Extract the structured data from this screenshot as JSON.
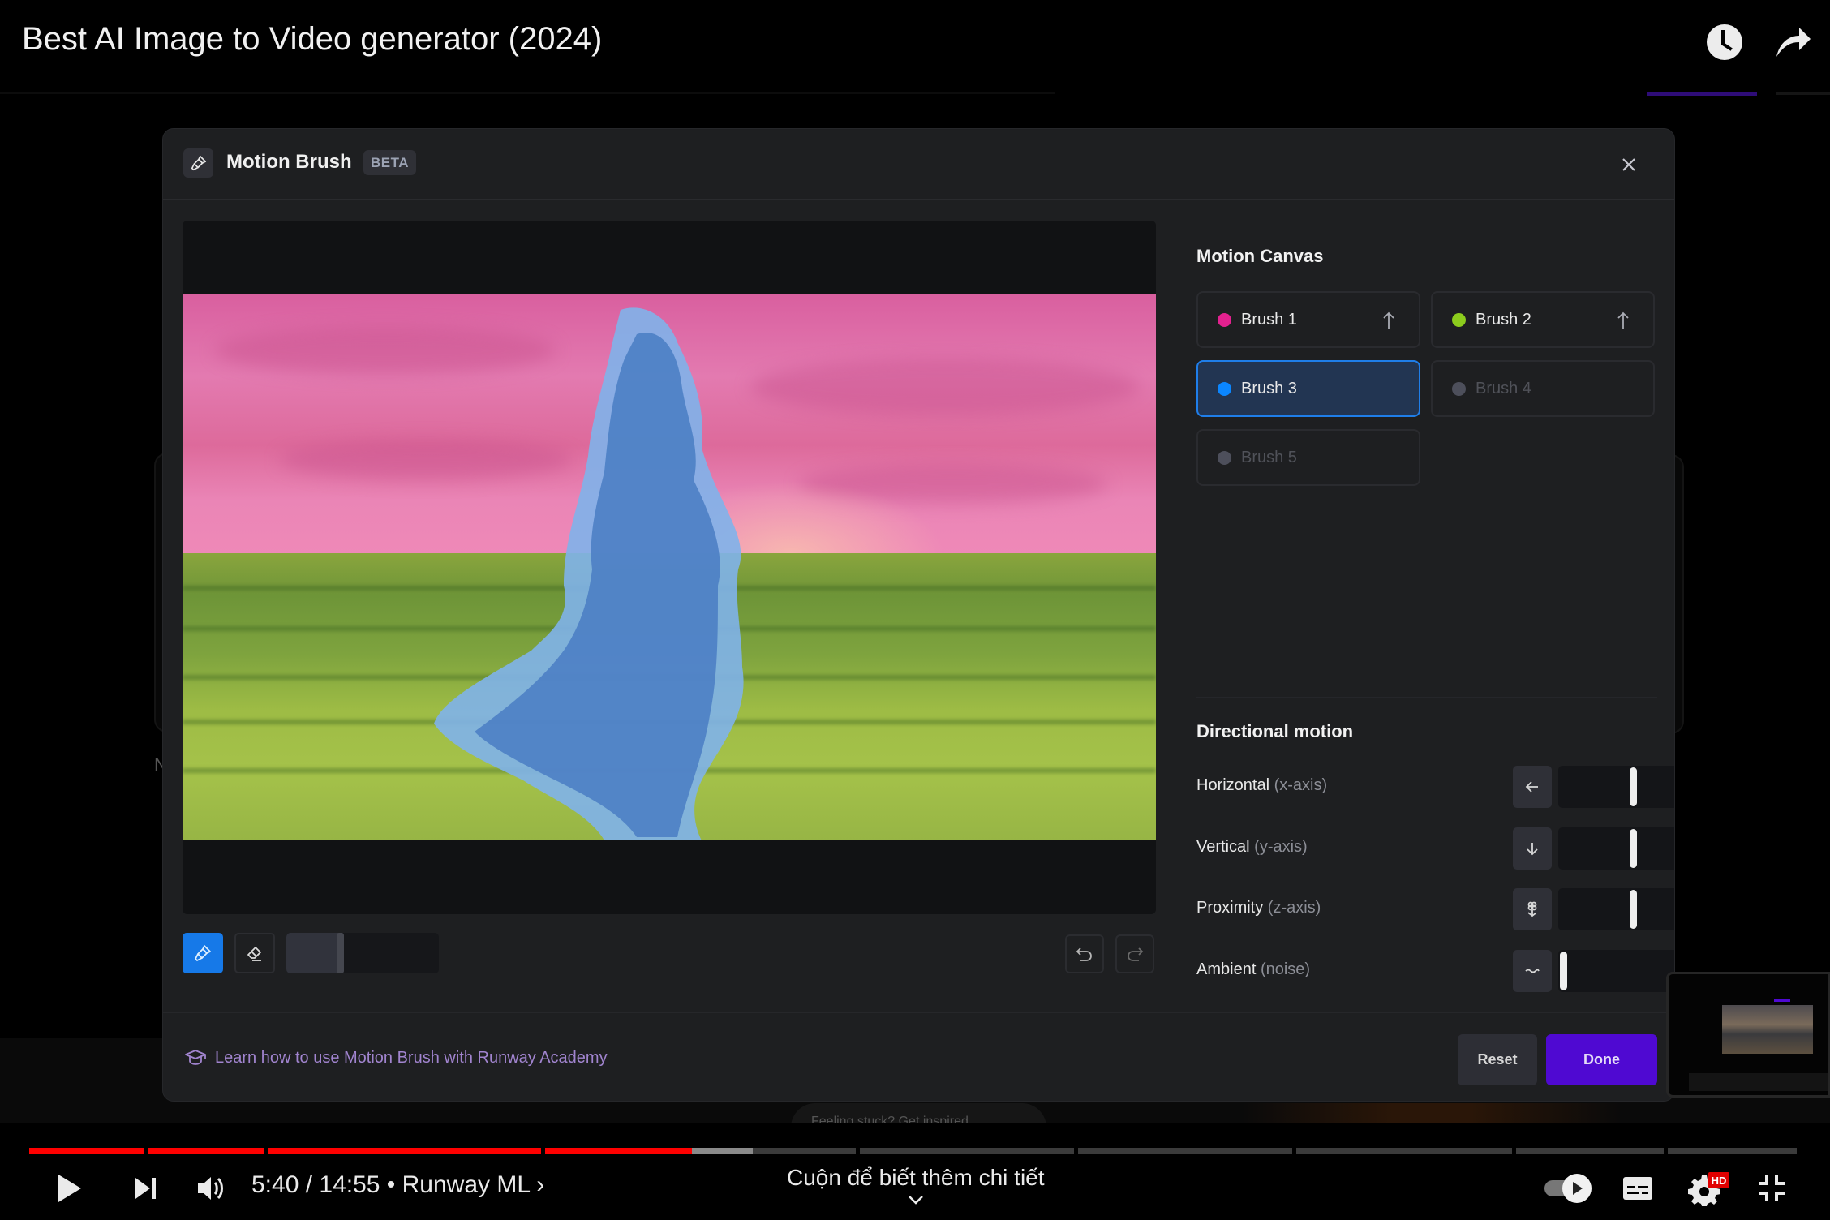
{
  "video": {
    "title": "Best AI Image to Video generator (2024)",
    "top_icons": [
      "watch-later-icon",
      "share-icon"
    ]
  },
  "modal": {
    "title": "Motion Brush",
    "badge": "BETA",
    "close_icon": "close-icon",
    "canvas": {
      "tools": {
        "brush_active": true,
        "brush_size_fraction": 0.33
      }
    },
    "motion_canvas": {
      "title": "Motion Canvas",
      "brushes": [
        {
          "label": "Brush 1",
          "color": "#e3218f",
          "state": "assigned",
          "has_motion_icon": true
        },
        {
          "label": "Brush 2",
          "color": "#8ccc1d",
          "state": "assigned",
          "has_motion_icon": true
        },
        {
          "label": "Brush 3",
          "color": "#0b86ff",
          "state": "active",
          "has_motion_icon": false
        },
        {
          "label": "Brush 4",
          "color": "#4d4f5b",
          "state": "disabled",
          "has_motion_icon": false
        },
        {
          "label": "Brush 5",
          "color": "#4d4f5b",
          "state": "disabled",
          "has_motion_icon": false
        }
      ]
    },
    "directional_motion": {
      "title": "Directional motion",
      "rows": [
        {
          "label": "Horizontal",
          "sub": "(x-axis)",
          "left_icon": "arrow-left-icon",
          "right_icon": "arrow-right-icon",
          "value": "0.0",
          "position": 0.5
        },
        {
          "label": "Vertical",
          "sub": "(y-axis)",
          "left_icon": "arrow-down-icon",
          "right_icon": "arrow-up-icon",
          "value": "0.0",
          "position": 0.5
        },
        {
          "label": "Proximity",
          "sub": "(z-axis)",
          "left_icon": "flower-small-icon",
          "right_icon": "flower-large-icon",
          "value": "0.0",
          "position": 0.5
        },
        {
          "label": "Ambient",
          "sub": "(noise)",
          "left_icon": "wave-low-icon",
          "right_icon": "wave-high-icon",
          "value": "0.0",
          "position": 0.0
        }
      ]
    },
    "footer": {
      "academy_link": "Learn how to use Motion Brush with Runway Academy",
      "reset_label": "Reset",
      "done_label": "Done"
    }
  },
  "background": {
    "pill_text": "Feeling stuck? Get inspired",
    "ghost_letter": "N"
  },
  "player": {
    "time": "5:40 / 14:55 • Runway ML ›",
    "scroll_hint": "Cuộn để biết thêm chi tiết",
    "played_fraction": 0.375,
    "buffered_fraction": 0.41,
    "chapters": [
      0.063,
      0.063,
      0.146,
      0.166,
      0.115,
      0.115,
      0.116,
      0.08,
      0.07
    ],
    "autoplay_on": true,
    "quality_badge": "HD",
    "colors": {
      "played": "#ff0000",
      "buffered": "#8a8a8a",
      "unplayed": "#3b3b3b"
    }
  },
  "theme": {
    "accent_blue": "#1679e8",
    "done_purple": "#4f09d2",
    "link_purple": "#a184cf"
  }
}
